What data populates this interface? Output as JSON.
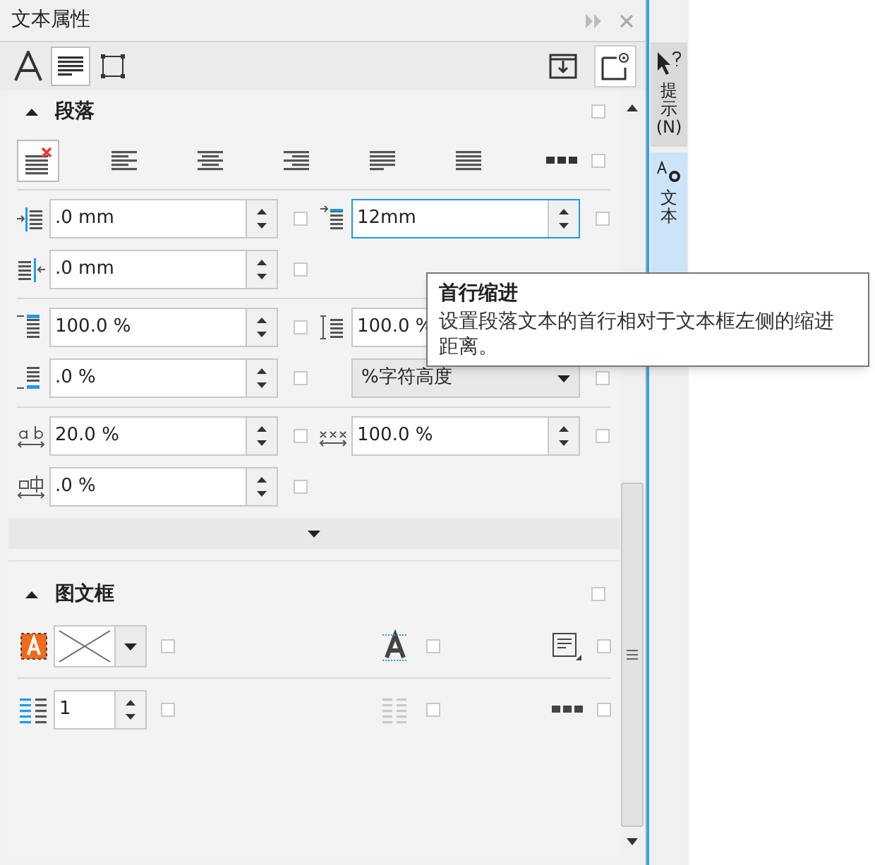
{
  "panel": {
    "title": "文本属性"
  },
  "tabs": [
    {
      "kind": "character",
      "selected": false
    },
    {
      "kind": "paragraph",
      "selected": true
    },
    {
      "kind": "frame",
      "selected": false
    }
  ],
  "side_tabs": [
    {
      "label": "提示(N)",
      "selected": false
    },
    {
      "label": "文本",
      "selected": true
    }
  ],
  "paragraph": {
    "title": "段落",
    "expanded": true,
    "checked": false,
    "alignments": [
      {
        "kind": "none",
        "selected": true
      },
      {
        "kind": "left",
        "selected": false
      },
      {
        "kind": "center",
        "selected": false
      },
      {
        "kind": "right",
        "selected": false
      },
      {
        "kind": "full",
        "selected": false
      },
      {
        "kind": "force",
        "selected": false
      }
    ],
    "alignment_checked": false,
    "groups": [
      {
        "rows": [
          {
            "cells": [
              {
                "kind": "spin",
                "value": ".0 mm",
                "focused": false,
                "checked": false
              },
              {
                "kind": "spin",
                "value": "12mm",
                "focused": true,
                "checked": false
              }
            ]
          },
          {
            "cells": [
              {
                "kind": "spin",
                "value": ".0 mm",
                "focused": false,
                "checked": false
              }
            ]
          }
        ]
      },
      {
        "rows": [
          {
            "cells": [
              {
                "kind": "spin",
                "value": "100.0 %",
                "focused": false,
                "checked": false
              },
              {
                "kind": "spin",
                "value": "100.0 %",
                "focused": false
              }
            ]
          },
          {
            "cells": [
              {
                "kind": "spin",
                "value": ".0 %",
                "focused": false,
                "checked": false
              },
              {
                "kind": "dropdown",
                "value": "%字符高度",
                "checked": false
              }
            ]
          }
        ]
      },
      {
        "rows": [
          {
            "cells": [
              {
                "kind": "spin",
                "value": "20.0 %",
                "focused": false,
                "checked": false
              },
              {
                "kind": "spin",
                "value": "100.0 %",
                "focused": false,
                "checked": false
              }
            ]
          },
          {
            "cells": [
              {
                "kind": "spin",
                "value": ".0 %",
                "focused": false,
                "checked": false
              }
            ]
          }
        ]
      }
    ]
  },
  "frame": {
    "title": "图文框",
    "expanded": true,
    "checked": false,
    "rows": [
      {
        "cells": [
          {
            "kind": "fill-dropdown",
            "checked": false
          },
          {
            "kind": "toggle",
            "disabled": false,
            "checked": false
          },
          {
            "kind": "toggle",
            "disabled": false,
            "checked": false
          }
        ]
      },
      {
        "cells": [
          {
            "kind": "spin",
            "value": "1",
            "checked": false
          },
          {
            "kind": "toggle",
            "disabled": true,
            "checked": false
          },
          {
            "kind": "toggle",
            "disabled": false,
            "checked": false
          }
        ]
      }
    ]
  },
  "tooltip": {
    "title": "首行缩进",
    "body": "设置段落文本的首行相对于文本框左侧的缩进距离。"
  }
}
